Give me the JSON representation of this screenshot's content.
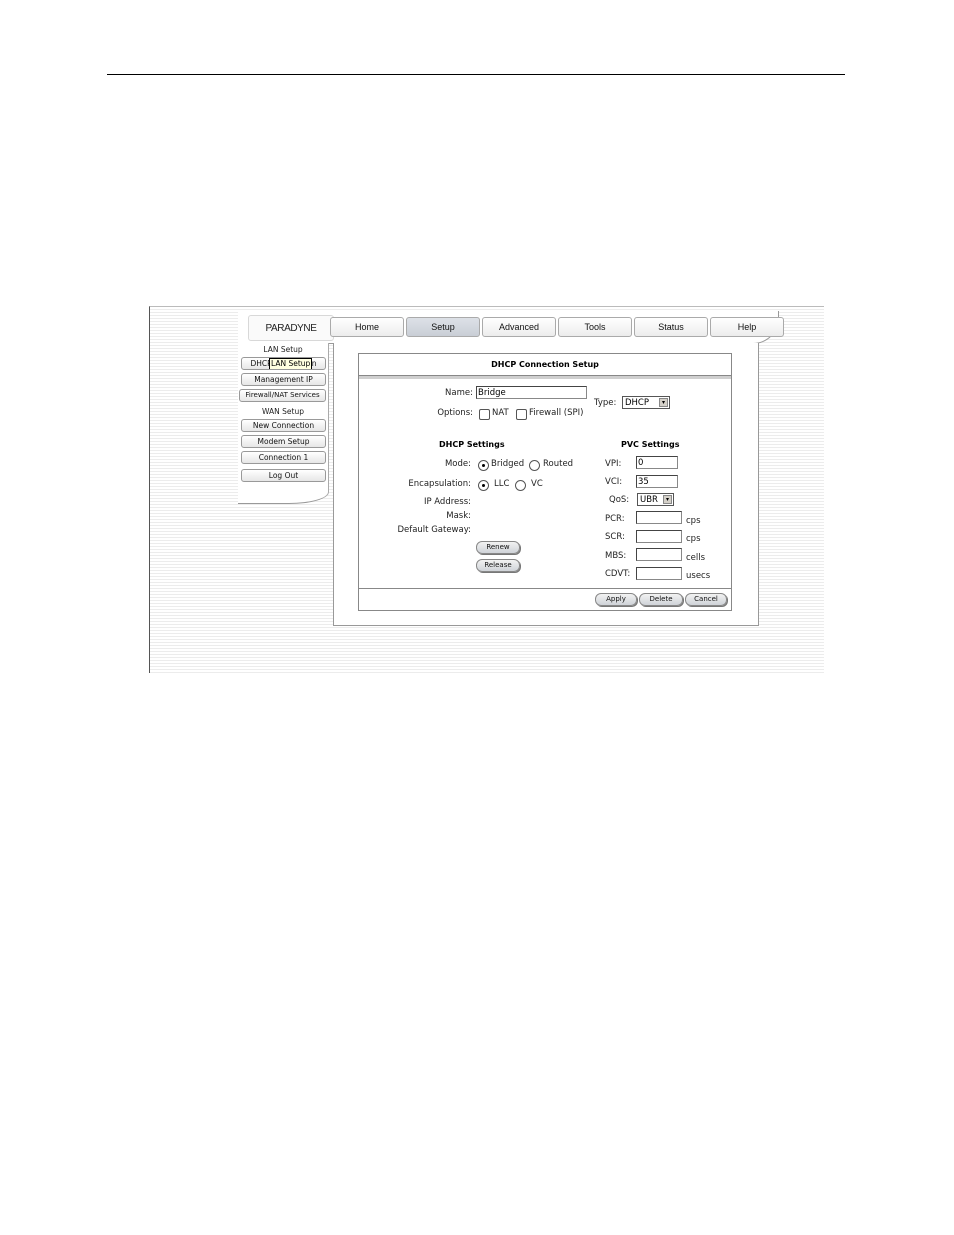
{
  "app": {
    "logo": "PARADYNE",
    "tabs": [
      {
        "label": "Home",
        "active": false
      },
      {
        "label": "Setup",
        "active": true
      },
      {
        "label": "Advanced",
        "active": false
      },
      {
        "label": "Tools",
        "active": false
      },
      {
        "label": "Status",
        "active": false
      },
      {
        "label": "Help",
        "active": false
      }
    ]
  },
  "sidebar": {
    "lan_heading": "LAN Setup",
    "lan_items": [
      "DHCP Connection",
      "Management IP",
      "Firewall/NAT Services"
    ],
    "wan_heading": "WAN Setup",
    "wan_items": [
      "New Connection",
      "Modem Setup",
      "Connection 1"
    ],
    "logout": "Log Out",
    "tooltip": "LAN Setup"
  },
  "panel": {
    "title": "DHCP Connection Setup",
    "name_label": "Name:",
    "name_value": "Bridge",
    "options_label": "Options:",
    "opt_nat": "NAT",
    "opt_firewall": "Firewall (SPI)",
    "type_label": "Type:",
    "type_value": "DHCP",
    "dhcp": {
      "heading": "DHCP Settings",
      "mode_label": "Mode:",
      "mode_bridged": "Bridged",
      "mode_routed": "Routed",
      "mode_selected": "Bridged",
      "encap_label": "Encapsulation:",
      "encap_llc": "LLC",
      "encap_vc": "VC",
      "encap_selected": "LLC",
      "ip_label": "IP Address:",
      "mask_label": "Mask:",
      "gateway_label": "Default Gateway:",
      "renew": "Renew",
      "release": "Release"
    },
    "pvc": {
      "heading": "PVC Settings",
      "vpi_label": "VPI:",
      "vpi_value": "0",
      "vci_label": "VCI:",
      "vci_value": "35",
      "qos_label": "QoS:",
      "qos_value": "UBR",
      "pcr_label": "PCR:",
      "pcr_unit": "cps",
      "scr_label": "SCR:",
      "scr_unit": "cps",
      "mbs_label": "MBS:",
      "mbs_unit": "cells",
      "cdvt_label": "CDVT:",
      "cdvt_unit": "usecs"
    },
    "buttons": {
      "apply": "Apply",
      "delete": "Delete",
      "cancel": "Cancel"
    }
  },
  "icons": {
    "dropdown_arrow": "▾"
  }
}
